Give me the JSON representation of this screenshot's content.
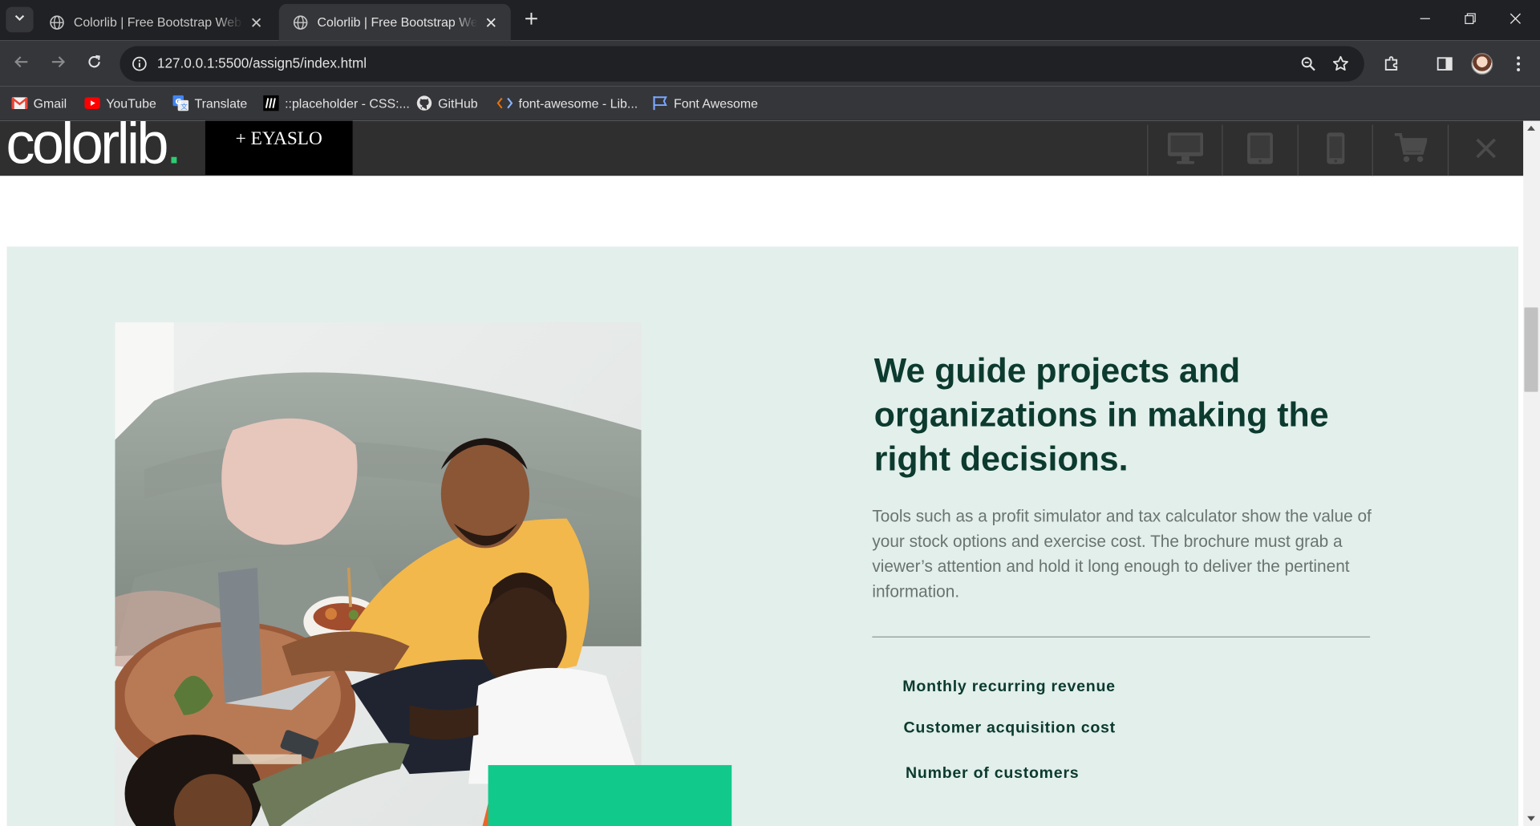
{
  "browser": {
    "tabs": [
      {
        "title": "Colorlib | Free Bootstrap Website Template",
        "active": false
      },
      {
        "title": "Colorlib | Free Bootstrap Website Template",
        "active": true
      }
    ],
    "url": "127.0.0.1:5500/assign5/index.html",
    "bookmarks": [
      {
        "label": "Gmail",
        "icon": "gmail-icon"
      },
      {
        "label": "YouTube",
        "icon": "youtube-icon"
      },
      {
        "label": "Translate",
        "icon": "translate-icon"
      },
      {
        "label": "::placeholder - CSS:...",
        "icon": "mdn-icon"
      },
      {
        "label": "GitHub",
        "icon": "github-icon"
      },
      {
        "label": "font-awesome - Lib...",
        "icon": "code-icon"
      },
      {
        "label": "Font Awesome",
        "icon": "flag-icon"
      }
    ]
  },
  "colorlib_bar": {
    "logo_text": "colorlib",
    "logo_dot": ".",
    "brand": "+ EYASLO",
    "buttons": [
      "desktop-icon",
      "tablet-icon",
      "mobile-icon",
      "cart-icon",
      "close-icon"
    ]
  },
  "section": {
    "headline": "We guide projects and organizations in making the right decisions.",
    "paragraph": "Tools such as a profit simulator and tax calculator show the value of your stock options and exercise cost. The brochure must grab a viewer’s attention and hold it long enough to deliver the pertinent information.",
    "features": [
      "Monthly recurring revenue",
      "Customer acquisition cost",
      "Number of customers"
    ]
  },
  "colors": {
    "section_bg": "#e2efeb",
    "headline": "#0c3a2e",
    "accent_green": "#12c98c",
    "logo_dot": "#2ecc71"
  }
}
